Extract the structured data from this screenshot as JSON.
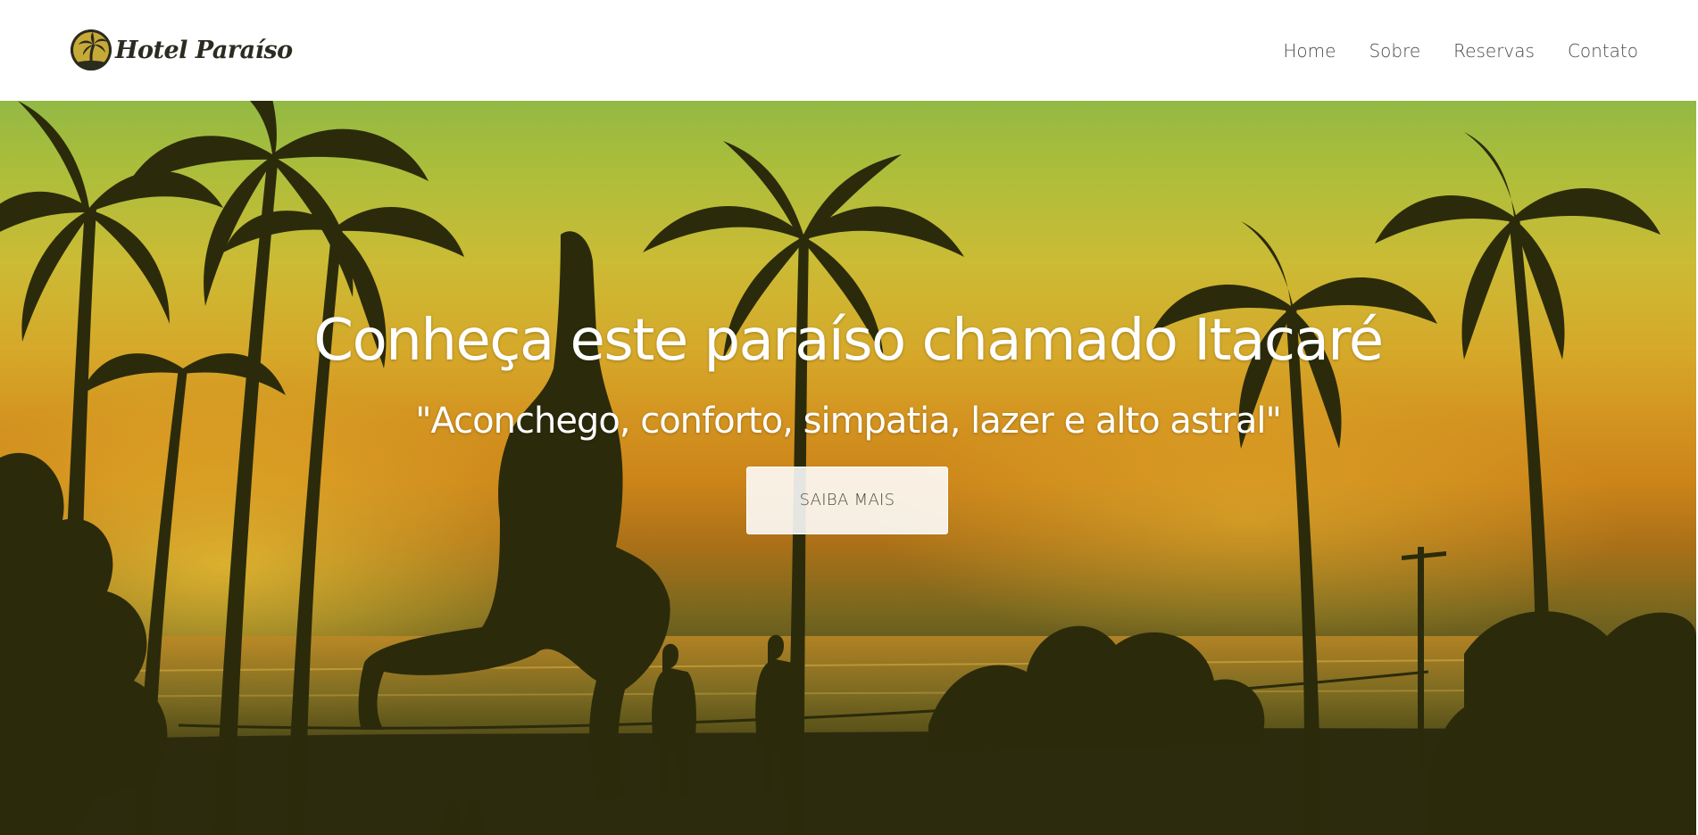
{
  "brand": {
    "name": "Hotel Paraíso",
    "logo_icon": "palm-tree-icon",
    "logo_color": "#2b2b1e"
  },
  "nav": {
    "items": [
      {
        "label": "Home"
      },
      {
        "label": "Sobre"
      },
      {
        "label": "Reservas"
      },
      {
        "label": "Contato"
      }
    ]
  },
  "hero": {
    "title": "Conheça este paraíso chamado Itacaré",
    "subtitle": "\"Aconchego, conforto, simpatia, lazer e alto astral\"",
    "cta_label": "SAIBA MAIS",
    "background": "tropical-beach-sunset-slackline-photo",
    "colors": {
      "sky_top": "#9ac44a",
      "sky_mid": "#e3b22e",
      "sunset": "#d88a1c",
      "silhouette": "#2a2a0c"
    }
  }
}
